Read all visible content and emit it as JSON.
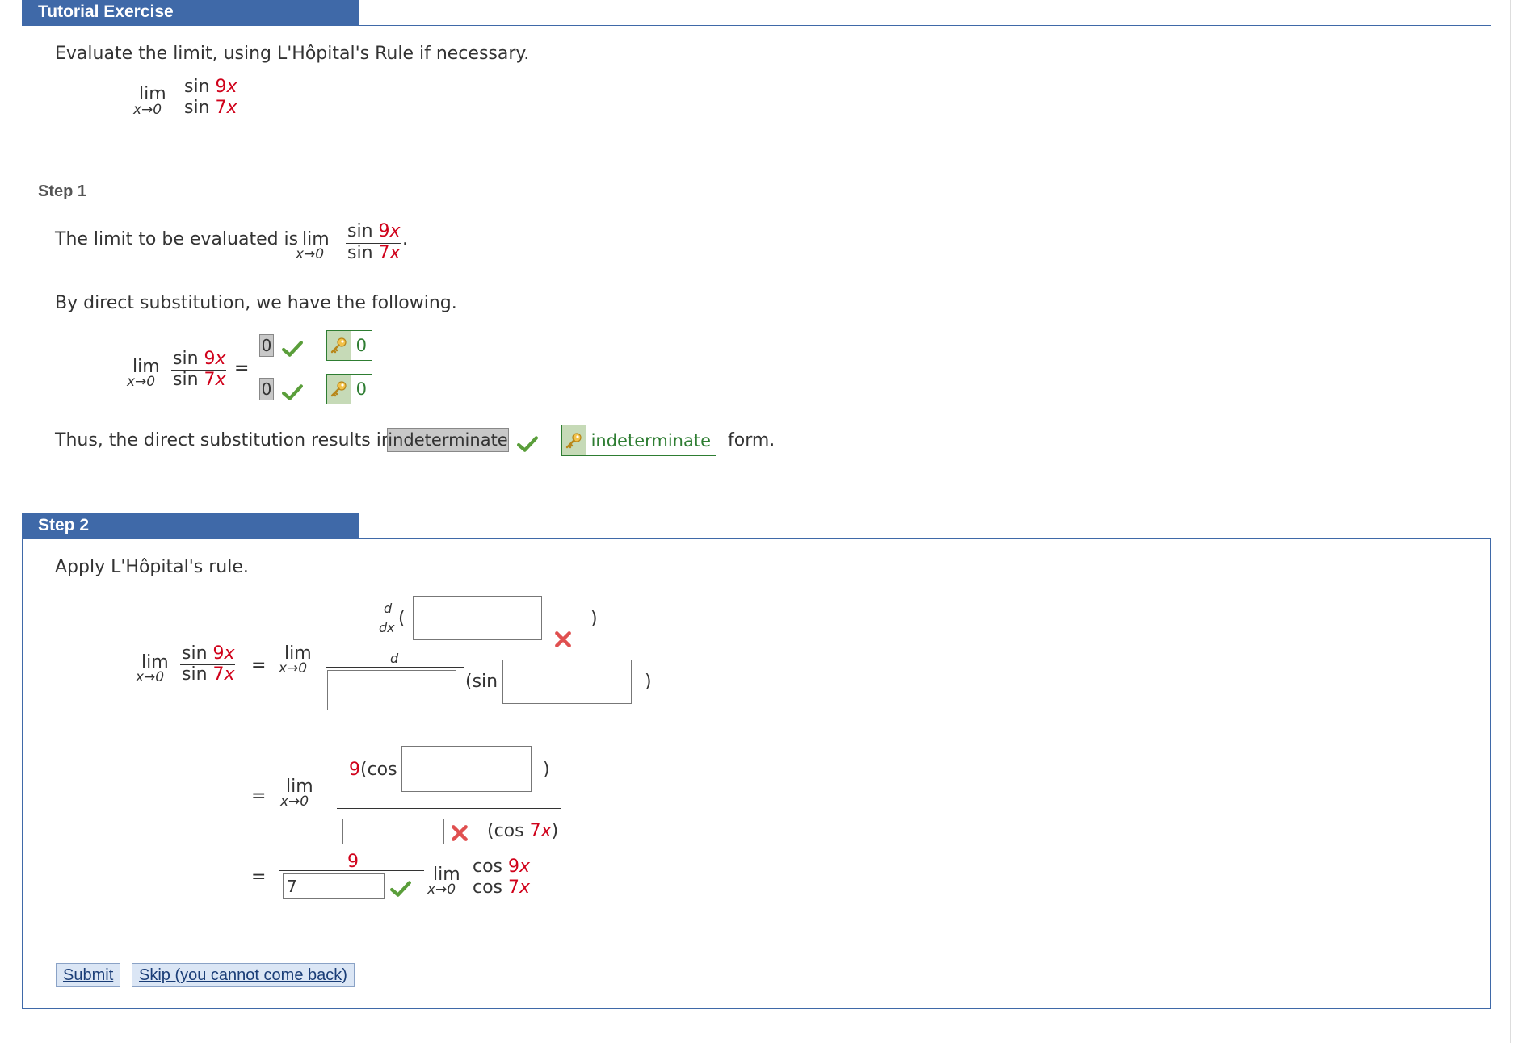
{
  "tutorial": {
    "title": "Tutorial Exercise",
    "instruction": "Evaluate the limit, using L'Hôpital's Rule if necessary."
  },
  "expr": {
    "lim": "lim",
    "approach": "x→0",
    "num_fn": "sin ",
    "num_coef": "9",
    "den_fn": "sin ",
    "den_coef": "7",
    "var": "x"
  },
  "step1": {
    "label": "Step 1",
    "sentence": "The limit to be evaluated is",
    "period": ".",
    "direct_sub": "By direct substitution, we have the following.",
    "eq": "=",
    "answer_num": "0",
    "answer_den": "0",
    "key_num": "0",
    "key_den": "0",
    "thus": "Thus, the direct substitution results in",
    "answer_form": "indeterminate",
    "key_form": "indeterminate",
    "form": "form."
  },
  "step2": {
    "label": "Step 2",
    "apply": "Apply L'Hôpital's rule.",
    "eq": "=",
    "d": "d",
    "dx": "dx",
    "open_paren": "(",
    "close_paren": ")",
    "sin_open": "(sin",
    "nine": "9",
    "cos_open": "(cos",
    "cos_den": "(cos ",
    "seven_x": "7",
    "close_x": ")",
    "final_num": "9",
    "final_den_value": "7",
    "cos_fn": "cos "
  },
  "buttons": {
    "submit": "Submit",
    "skip": "Skip (you cannot come back)"
  },
  "colors": {
    "header_bg": "#3f69a8",
    "accent_red": "#d0021b",
    "correct_green": "#5a9e3a",
    "wrong_red": "#e05050",
    "key_green": "#2e7d32"
  }
}
